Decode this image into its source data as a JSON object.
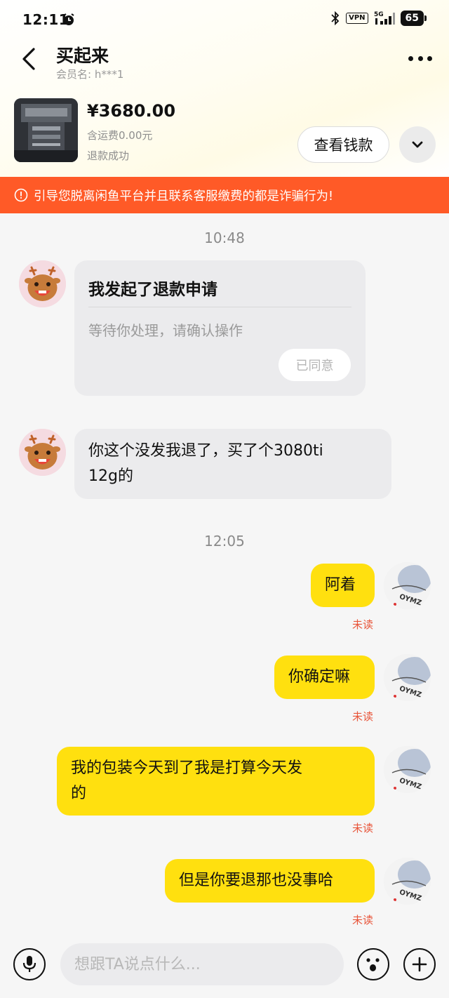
{
  "status_bar": {
    "time": "12:11",
    "network": "5G",
    "vpn": "VPN",
    "battery": "65"
  },
  "header": {
    "title": "买起来",
    "member": "会员名: h***1"
  },
  "product": {
    "price": "¥3680.00",
    "shipping": "含运费0.00元",
    "status": "退款成功",
    "view_money_label": "查看钱款"
  },
  "warning": {
    "text": "引导您脱离闲鱼平台并且联系客服缴费的都是诈骗行为!"
  },
  "chat": {
    "time1": "10:48",
    "refund_card": {
      "title": "我发起了退款申请",
      "desc": "等待你处理，请确认操作",
      "agreed_label": "已同意"
    },
    "incoming_msg": {
      "line1": "你这个没发我退了，买了个3080ti",
      "line2": "12g的"
    },
    "time2": "12:05",
    "outgoing": [
      {
        "line1": "阿着",
        "line2": "",
        "status": "未读"
      },
      {
        "line1": "你确定嘛",
        "line2": "",
        "status": "未读"
      },
      {
        "line1": "我的包装今天到了我是打算今天发",
        "line2": "的",
        "status": "未读"
      },
      {
        "line1": "但是你要退那也没事哈",
        "line2": "",
        "status": "未读"
      }
    ]
  },
  "input_bar": {
    "placeholder": "想跟TA说点什么..."
  },
  "colors": {
    "accent_yellow": "#ffe00f",
    "warning_orange": "#ff5a27",
    "unread_red": "#e8553a",
    "incoming_bubble": "#ebebed"
  },
  "icons": [
    "alarm-icon",
    "bluetooth-icon",
    "signal-icon",
    "battery-icon",
    "back-icon",
    "more-icon",
    "chevron-down-icon",
    "warning-icon",
    "deer-avatar",
    "user-avatar",
    "mic-icon",
    "emoji-icon",
    "plus-icon"
  ]
}
